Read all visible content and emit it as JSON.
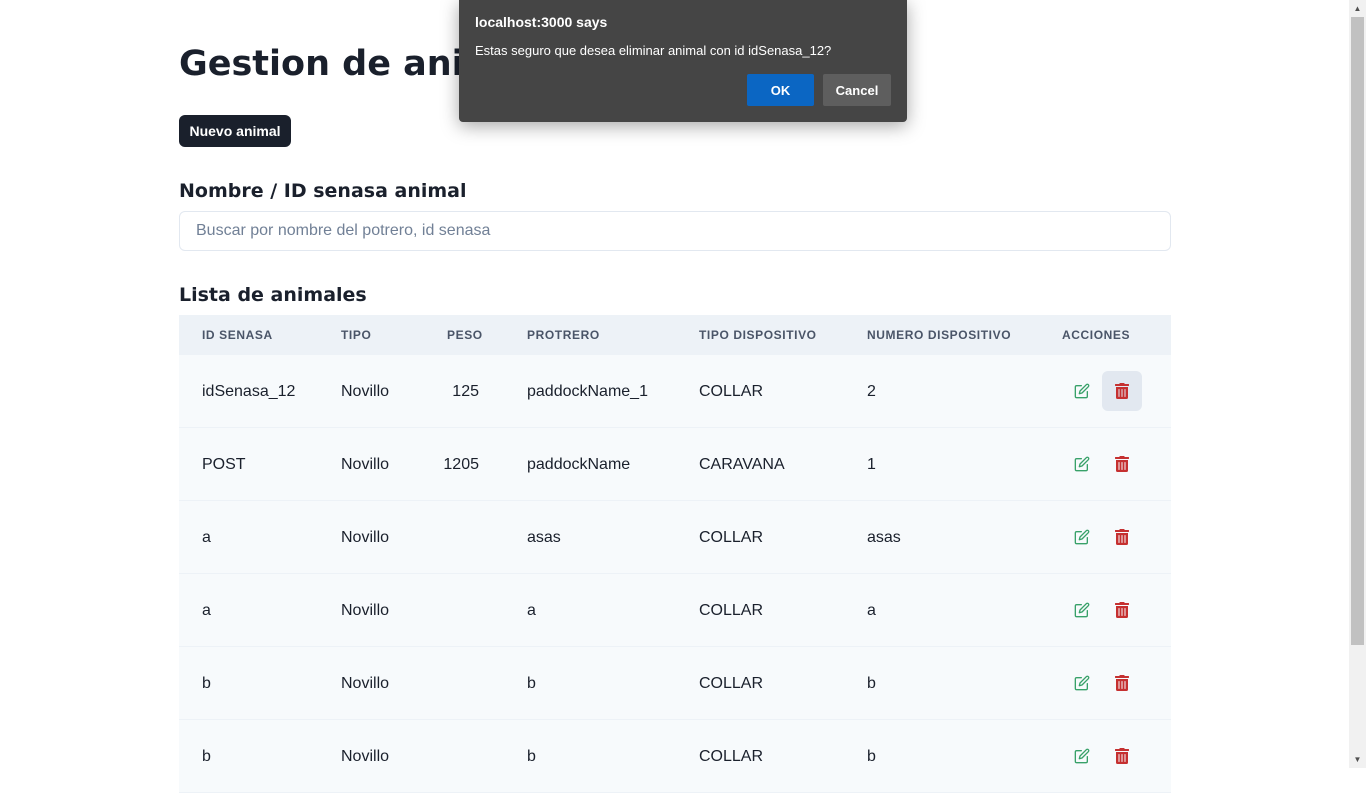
{
  "page": {
    "title": "Gestion de animales",
    "new_button": "Nuevo animal",
    "search_label": "Nombre / ID senasa animal",
    "search_placeholder": "Buscar por nombre del potrero, id senasa",
    "search_value": "",
    "list_label": "Lista de animales"
  },
  "table": {
    "headers": [
      "ID SENASA",
      "TIPO",
      "PESO",
      "PROTRERO",
      "TIPO DISPOSITIVO",
      "NUMERO DISPOSITIVO",
      "ACCIONES"
    ],
    "rows": [
      {
        "id": "idSenasa_12",
        "tipo": "Novillo",
        "peso": "125",
        "potrero": "paddockName_1",
        "tipo_dispositivo": "COLLAR",
        "numero_dispositivo": "2"
      },
      {
        "id": "POST",
        "tipo": "Novillo",
        "peso": "1205",
        "potrero": "paddockName",
        "tipo_dispositivo": "CARAVANA",
        "numero_dispositivo": "1"
      },
      {
        "id": "a",
        "tipo": "Novillo",
        "peso": "",
        "potrero": "asas",
        "tipo_dispositivo": "COLLAR",
        "numero_dispositivo": "asas"
      },
      {
        "id": "a",
        "tipo": "Novillo",
        "peso": "",
        "potrero": "a",
        "tipo_dispositivo": "COLLAR",
        "numero_dispositivo": "a"
      },
      {
        "id": "b",
        "tipo": "Novillo",
        "peso": "",
        "potrero": "b",
        "tipo_dispositivo": "COLLAR",
        "numero_dispositivo": "b"
      },
      {
        "id": "b",
        "tipo": "Novillo",
        "peso": "",
        "potrero": "b",
        "tipo_dispositivo": "COLLAR",
        "numero_dispositivo": "b"
      }
    ],
    "actions": {
      "edit_icon": "edit-icon",
      "delete_icon": "trash-icon"
    }
  },
  "colors": {
    "edit": "#38a169",
    "delete": "#c53030",
    "primary_button": "#1a202c",
    "dialog_ok": "#0b66c3"
  },
  "dialog": {
    "title": "localhost:3000 says",
    "message": "Estas seguro que desea eliminar animal con id idSenasa_12?",
    "ok_label": "OK",
    "cancel_label": "Cancel"
  }
}
